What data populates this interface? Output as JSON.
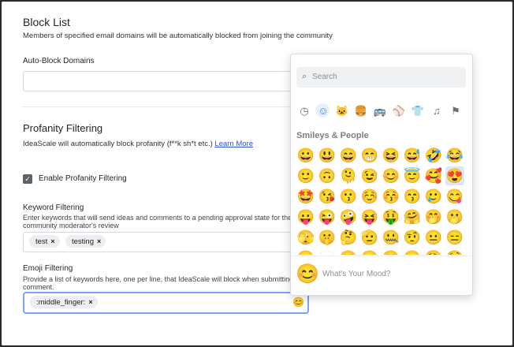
{
  "block_list": {
    "title": "Block List",
    "description": "Members of specified email domains will be automatically blocked from joining the community",
    "auto_block_label": "Auto-Block Domains"
  },
  "profanity": {
    "title": "Profanity Filtering",
    "description_prefix": "IdeaScale will automatically block profanity (f**k sh*t etc.)",
    "learn_more": "Learn More",
    "enable_label": "Enable Profanity Filtering",
    "enabled": true,
    "keyword_label": "Keyword Filtering",
    "keyword_desc_line1": "Enter keywords that will send ideas and comments to a pending approval state for the",
    "keyword_desc_line2": "community moderator's review",
    "keywords": [
      "test",
      "testing"
    ],
    "emoji_label": "Emoji Filtering",
    "emoji_desc_line1": "Provide a list of keywords here, one per line, that IdeaScale will block when submitting idea",
    "emoji_desc_line2": "comment.",
    "emoji_tags": [
      ":middle_finger:"
    ],
    "remove_glyph": "×"
  },
  "emoji_picker": {
    "search_placeholder": "Search",
    "categories": [
      {
        "name": "recent",
        "glyph": "◷"
      },
      {
        "name": "smileys",
        "glyph": "☺"
      },
      {
        "name": "animals",
        "glyph": "🐱"
      },
      {
        "name": "food",
        "glyph": "🍔"
      },
      {
        "name": "travel",
        "glyph": "🚌"
      },
      {
        "name": "activities",
        "glyph": "⚾"
      },
      {
        "name": "objects",
        "glyph": "👕"
      },
      {
        "name": "symbols",
        "glyph": "♫"
      },
      {
        "name": "flags",
        "glyph": "⚑"
      }
    ],
    "selected_category": 1,
    "section_title": "Smileys & People",
    "emojis": [
      [
        "😀",
        "😃",
        "😄",
        "😁",
        "😆",
        "😅",
        "🤣",
        "😂"
      ],
      [
        "🙂",
        "🙃",
        "🫠",
        "😉",
        "😊",
        "😇",
        "🥰",
        "😍"
      ],
      [
        "🤩",
        "😘",
        "😗",
        "☺️",
        "😚",
        "😙",
        "🥲",
        "😋"
      ],
      [
        "😛",
        "😜",
        "🤪",
        "😝",
        "🤑",
        "🤗",
        "🤭",
        "🫢"
      ],
      [
        "🫣",
        "🤫",
        "🤔",
        "🫡",
        "🤐",
        "🤨",
        "😐",
        "😑"
      ],
      [
        "😶",
        "🫥",
        "😏",
        "😒",
        "🙄",
        "😬",
        "😮‍💨",
        "🤥"
      ]
    ],
    "highlighted": "😍",
    "footer_emoji": "😊",
    "footer_placeholder": "What's Your Mood?"
  },
  "emoji_button_glyph": "😊"
}
